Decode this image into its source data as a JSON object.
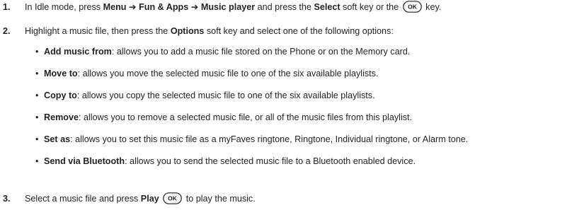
{
  "steps": [
    {
      "num": "1.",
      "parts": [
        {
          "t": "In Idle mode, press "
        },
        {
          "t": "Menu",
          "b": true
        },
        {
          "t": " ➔ "
        },
        {
          "t": "Fun & Apps",
          "b": true
        },
        {
          "t": " ➔ "
        },
        {
          "t": "Music player",
          "b": true
        },
        {
          "t": " and press the "
        },
        {
          "t": "Select",
          "b": true
        },
        {
          "t": " soft key or the "
        },
        {
          "icon": "ok-key-icon",
          "label": "OK"
        },
        {
          "t": " key."
        }
      ]
    },
    {
      "num": "2.",
      "parts": [
        {
          "t": "Highlight a music file, then press the "
        },
        {
          "t": "Options",
          "b": true
        },
        {
          "t": " soft key and select one of the following options:"
        }
      ]
    },
    {
      "num": "3.",
      "parts": [
        {
          "t": "Select a music file and press "
        },
        {
          "t": "Play",
          "b": true
        },
        {
          "t": " "
        },
        {
          "icon": "ok-key-icon",
          "label": "OK"
        },
        {
          "t": " to play the music."
        }
      ]
    }
  ],
  "bullets": [
    {
      "term": "Add music from",
      "desc": ": allows you to add a music file stored on the Phone or on the Memory card."
    },
    {
      "term": "Move to",
      "desc": ": allows you move the selected music file to one of the six available playlists."
    },
    {
      "term": "Copy to",
      "desc": ": allows you copy the selected music file to one of the six available playlists."
    },
    {
      "term": "Remove",
      "desc": ": allows you to remove a selected music file, or all of the music files from this playlist."
    },
    {
      "term": "Set as",
      "desc": ": allows you to set this music file as a myFaves ringtone, Ringtone, Individual ringtone, or Alarm tone."
    },
    {
      "term": "Send via Bluetooth",
      "desc": ": allows you to send the selected music file to a Bluetooth enabled device."
    }
  ],
  "bullet_glyph": "•"
}
